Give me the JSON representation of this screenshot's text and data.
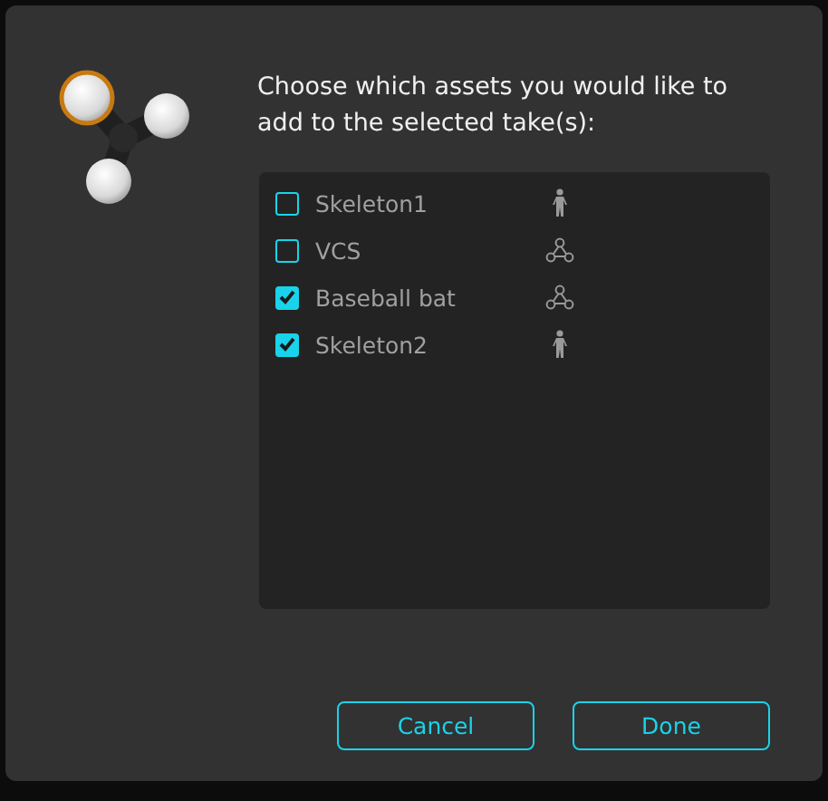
{
  "dialog": {
    "prompt": "Choose which assets you would like to add to the selected take(s):",
    "assets": [
      {
        "label": "Skeleton1",
        "checked": false,
        "kind": "skeleton"
      },
      {
        "label": "VCS",
        "checked": false,
        "kind": "rigidbody"
      },
      {
        "label": "Baseball bat",
        "checked": true,
        "kind": "rigidbody"
      },
      {
        "label": "Skeleton2",
        "checked": true,
        "kind": "skeleton"
      }
    ],
    "buttons": [
      "Cancel",
      "Done"
    ]
  }
}
